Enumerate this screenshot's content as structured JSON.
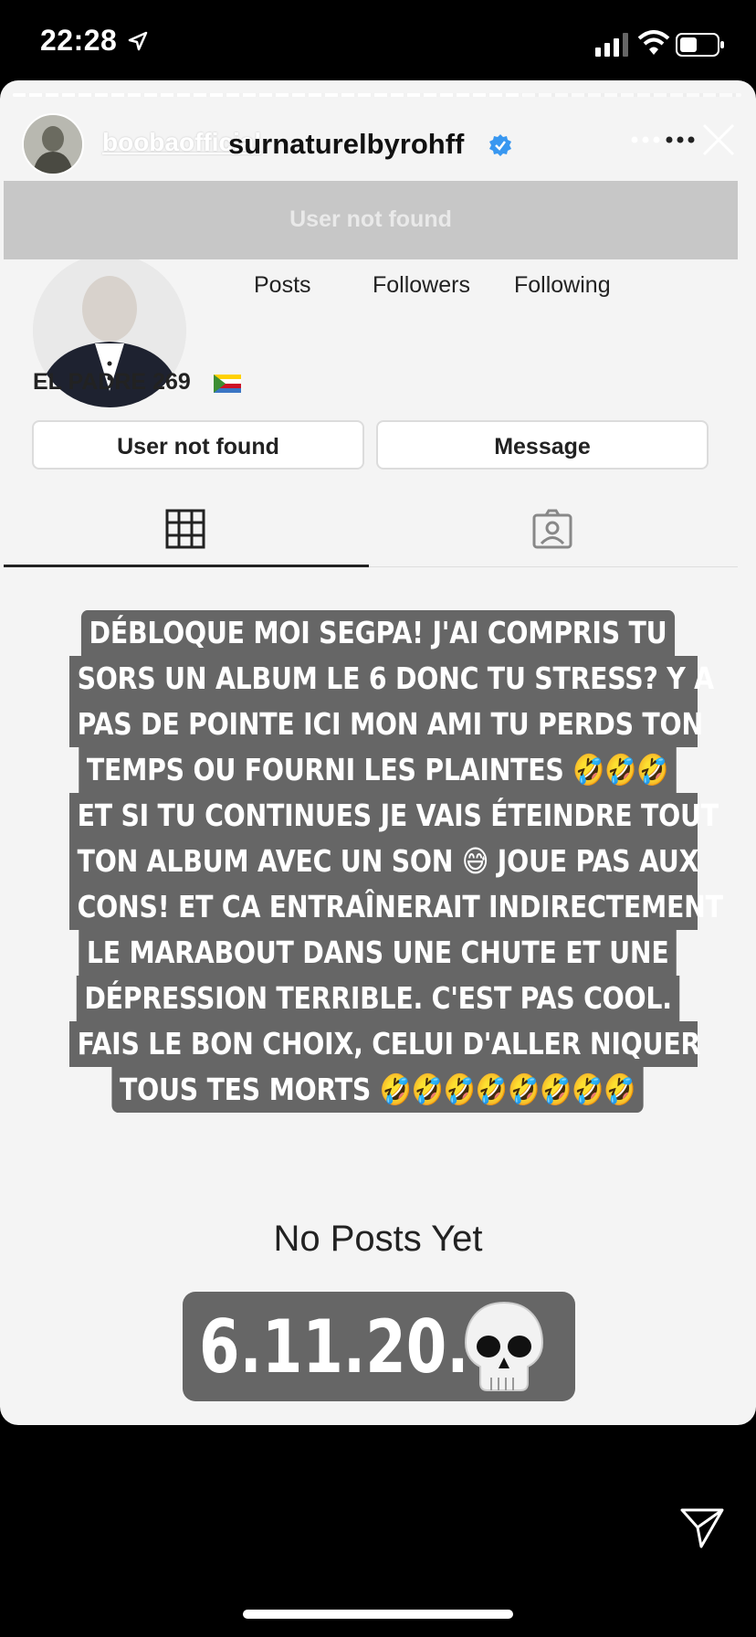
{
  "status_bar": {
    "time": "22:28"
  },
  "story": {
    "account": "boobaofficial",
    "profile_username": "surnaturelbyrohff",
    "banner_text": "User not found",
    "stats": {
      "posts": "Posts",
      "followers": "Followers",
      "following": "Following"
    },
    "bio": "EL PADRE 269",
    "buttons": {
      "left": "User not found",
      "right": "Message"
    },
    "caption_lines": [
      "DÉBLOQUE MOI SEGPA! J'AI COMPRIS TU",
      "SORS UN ALBUM LE 6 DONC TU STRESS? Y A",
      "PAS DE POINTE ICI MON AMI TU PERDS TON",
      "TEMPS OU FOURNI LES PLAINTES 🤣🤣🤣",
      "ET SI TU CONTINUES JE VAIS ÉTEINDRE TOUT",
      "TON ALBUM AVEC UN SON 😅 JOUE PAS AUX",
      "CONS! ET CA ENTRAÎNERAIT INDIRECTEMENT",
      "LE MARABOUT DANS UNE CHUTE ET UNE",
      "DÉPRESSION TERRIBLE. C'EST PAS COOL.",
      "FAIS LE BON CHOIX, CELUI D'ALLER NIQUER",
      "TOUS TES MORTS 🤣🤣🤣🤣🤣🤣🤣🤣"
    ],
    "no_posts": "No Posts Yet",
    "date_sticker": "6.11.20."
  },
  "colors": {
    "caption_bg": "#666666",
    "verified": "#3897f0",
    "story_bg": "#f4f4f4"
  }
}
